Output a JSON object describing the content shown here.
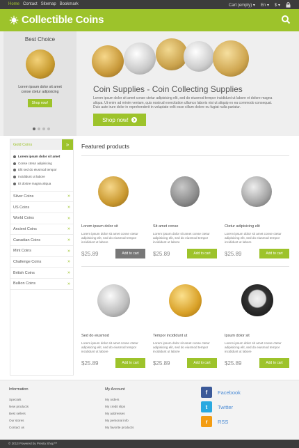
{
  "topbar": {
    "nav": [
      "Home",
      "Contact",
      "Sitemap",
      "Bookmark"
    ],
    "cart": "Cart (empty)",
    "language": "En",
    "currency": "$"
  },
  "header": {
    "logo_text": "Collectible Coins"
  },
  "best_choice": {
    "heading": "Best Choice",
    "text_line1": "Lorem ipsum dolor sit amet",
    "text_line2": "conse ctetur adipisicing",
    "button": "Shop now!"
  },
  "slider": {
    "title": "Coin Supplies - Coin Collecting Supplies",
    "paragraph": "Lorem ipsum dolor sit amet conse ctetur adipisicing elit, sed do eiusmod tempor incididunt ut labore et dolore magna aliqua. Ut enim ad minim veniam, quis nostrud exercitation ullamco laboris nisi ut aliquip ex ea commodo consequat. Duis aute irure dolor in reprehenderit in voluptate velit esse cillum dolore eu fugiat nulla pariatur.",
    "button": "Shop now!"
  },
  "sidebar": {
    "gold": {
      "label": "Gold Coins",
      "subitems": [
        "Lorem ipsum dolor sit amet",
        "Conse ctetur adipisicing",
        "Elit sed do eiusmod tempor",
        "Incididunt ut labore",
        "Et dolore magna aliqua"
      ]
    },
    "categories": [
      "Silver Coins",
      "US Coins",
      "World Coins",
      "Ancient Coins",
      "Canadian Coins",
      "Mint Coins",
      "Challenge Coins",
      "British Coins",
      "Bullion Coins"
    ]
  },
  "featured": {
    "heading": "Featured products",
    "products": [
      {
        "name": "Lorem ipsum dolor sit",
        "desc": "Lorem ipsum dolor sit amet conse ctetur adipisicing elit, sed do eiusmod tempor incididunt ut labore",
        "price": "$25.89",
        "button": "Add to cart"
      },
      {
        "name": "Sit amet conse",
        "desc": "Lorem ipsum dolor sit amet conse ctetur adipisicing elit, sed do eiusmod tempor incididunt ut labore",
        "price": "$25.89",
        "button": "Add to cart"
      },
      {
        "name": "Ctetur adipisicing elit",
        "desc": "Lorem ipsum dolor sit amet conse ctetur adipisicing elit, sed do eiusmod tempor incididunt ut labore",
        "price": "$25.89",
        "button": "Add to cart"
      },
      {
        "name": "Sed do eiusmod",
        "desc": "Lorem ipsum dolor sit amet conse ctetur adipisicing elit, sed do eiusmod tempor incididunt ut labore",
        "price": "$25.89",
        "button": "Add to cart"
      },
      {
        "name": "Tempor incididunt ut",
        "desc": "Lorem ipsum dolor sit amet conse ctetur adipisicing elit, sed do eiusmod tempor incididunt ut labore",
        "price": "$25.89",
        "button": "Add to cart"
      },
      {
        "name": "Ipsum dolor sit",
        "desc": "Lorem ipsum dolor sit amet conse ctetur adipisicing elit, sed do eiusmod tempor incididunt ut labore",
        "price": "$25.89",
        "button": "Add to cart"
      }
    ]
  },
  "footer": {
    "information": {
      "heading": "Information",
      "links": [
        "Specials",
        "New products",
        "Best sellers",
        "Our stores",
        "Contact us"
      ]
    },
    "account": {
      "heading": "My Account",
      "links": [
        "My orders",
        "My credit slips",
        "My addresses",
        "My personal info",
        "My favorite products"
      ]
    },
    "social": [
      {
        "label": "Facebook",
        "glyph": "f",
        "color": "#3b5998"
      },
      {
        "label": "Twitter",
        "glyph": "t",
        "color": "#2aa9e0"
      },
      {
        "label": "RSS",
        "glyph": "r",
        "color": "#f39c12"
      }
    ],
    "copyright": "© 2013 Powered by Presta Shop™"
  },
  "colors": {
    "accent": "#9dc32b",
    "dark": "#3c3c3c"
  }
}
